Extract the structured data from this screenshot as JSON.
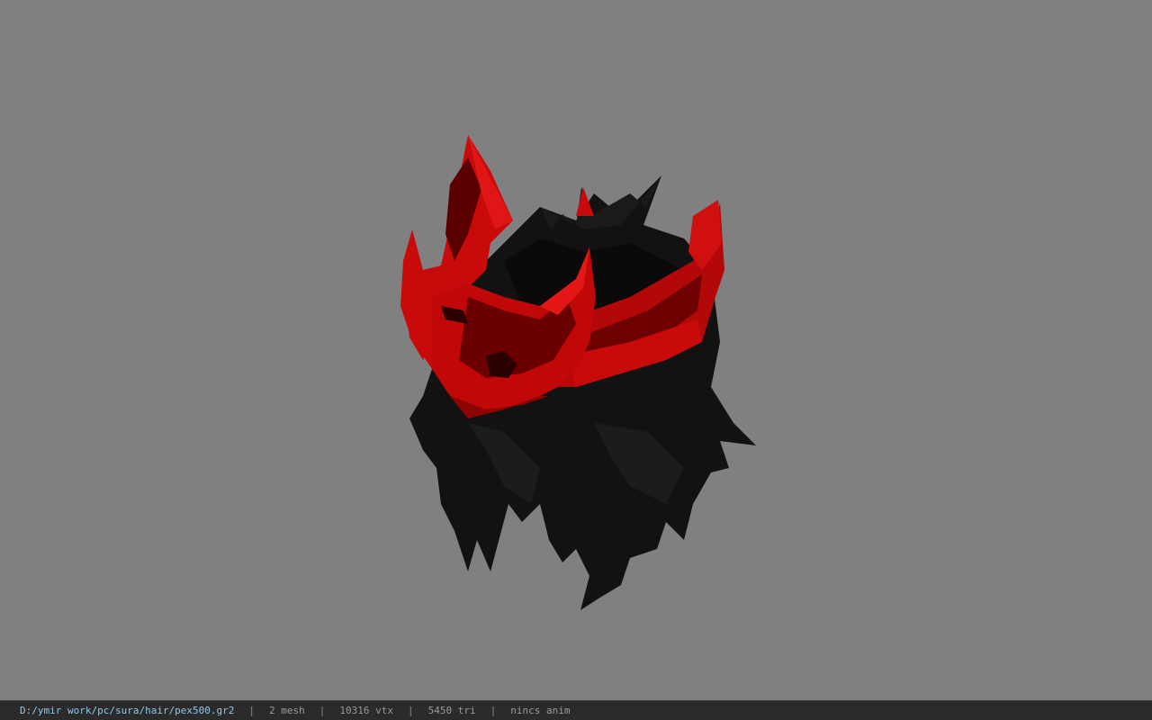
{
  "viewer": {
    "background_color": "#808080",
    "model": {
      "description_icon": "hair-model-icon",
      "colors": {
        "crown": "#c80a0a",
        "crown_dark": "#5a0000",
        "hair": "#111111"
      }
    }
  },
  "statusbar": {
    "file_path": "D:/ymir work/pc/sura/hair/pex500.gr2",
    "separator": "|",
    "mesh": "2 mesh",
    "vtx": "10316 vtx",
    "tri": "5450 tri",
    "anim": "nincs anim"
  }
}
